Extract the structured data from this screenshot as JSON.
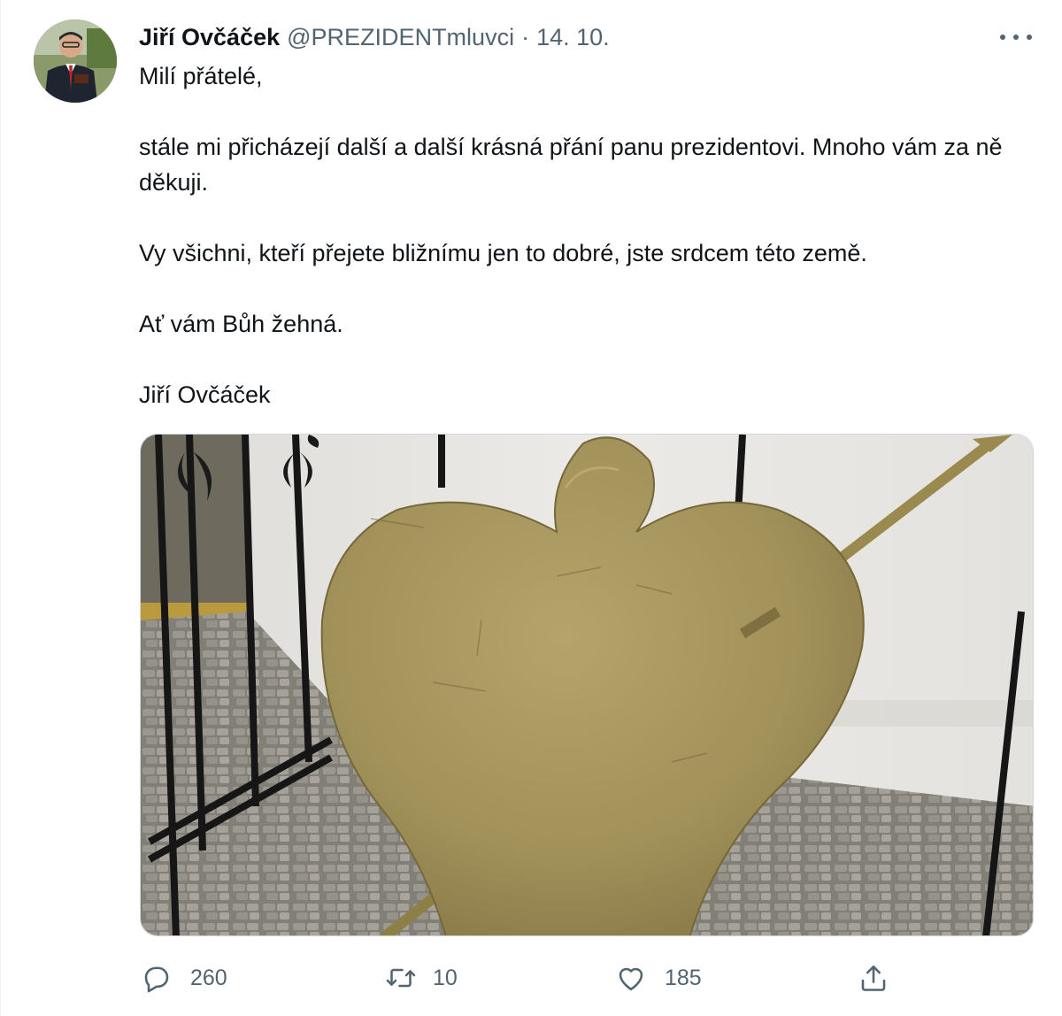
{
  "tweet": {
    "author_name": "Jiří Ovčáček",
    "handle": "@PREZIDENTmluvci",
    "separator": "·",
    "date": "14. 10.",
    "paragraphs": [
      "Milí přátelé,",
      "stále mi přicházejí další a další krásná přání panu prezidentovi. Mnoho vám za ně děkuji.",
      "Vy všichni, kteří přejete bližnímu jen to dobré, jste srdcem této země.",
      "Ať vám Bůh žehná.",
      "Jiří Ovčáček"
    ]
  },
  "actions": {
    "reply_count": "260",
    "retweet_count": "10",
    "like_count": "185"
  },
  "icons": {
    "more": "more-horizontal-icon",
    "reply": "reply-icon",
    "retweet": "retweet-icon",
    "like": "heart-icon",
    "share": "share-icon"
  },
  "colors": {
    "text": "#0f1419",
    "secondary": "#536471",
    "border": "#cfd9de"
  }
}
